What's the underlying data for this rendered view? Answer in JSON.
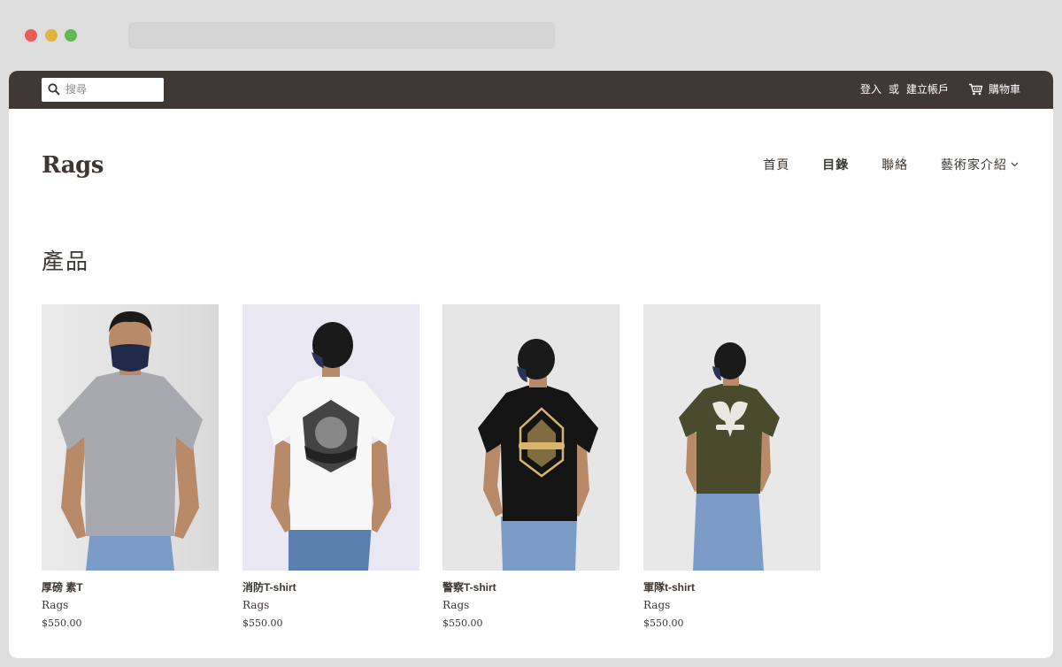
{
  "browser": {
    "traffic_lights": [
      "#ee5b57",
      "#e0b53d",
      "#5fbb4e"
    ]
  },
  "topbar": {
    "search_placeholder": "搜尋",
    "login": "登入",
    "or": "或",
    "create_account": "建立帳戶",
    "cart": "購物車"
  },
  "header": {
    "logo": "Rags",
    "nav": [
      {
        "label": "首頁",
        "active": false
      },
      {
        "label": "目錄",
        "active": true
      },
      {
        "label": "聯絡",
        "active": false
      },
      {
        "label": "藝術家介紹",
        "active": false,
        "dropdown": true
      }
    ]
  },
  "main": {
    "title": "產品",
    "products": [
      {
        "name": "厚磅 素T",
        "vendor": "Rags",
        "price": "$550.00",
        "shirt_color": "#a8a9ae",
        "bg": "#e4e4e4",
        "view": "front"
      },
      {
        "name": "消防T-shirt",
        "vendor": "Rags",
        "price": "$550.00",
        "shirt_color": "#f7f7f7",
        "bg": "#e9e8f2",
        "view": "back"
      },
      {
        "name": "警察T-shirt",
        "vendor": "Rags",
        "price": "$550.00",
        "shirt_color": "#141414",
        "bg": "#e6e6e6",
        "view": "back"
      },
      {
        "name": "軍隊t-shirt",
        "vendor": "Rags",
        "price": "$550.00",
        "shirt_color": "#4a4a2c",
        "bg": "#e8e8e8",
        "view": "back"
      }
    ]
  },
  "colors": {
    "topbar_bg": "#3f3834",
    "text": "#3d3632"
  }
}
